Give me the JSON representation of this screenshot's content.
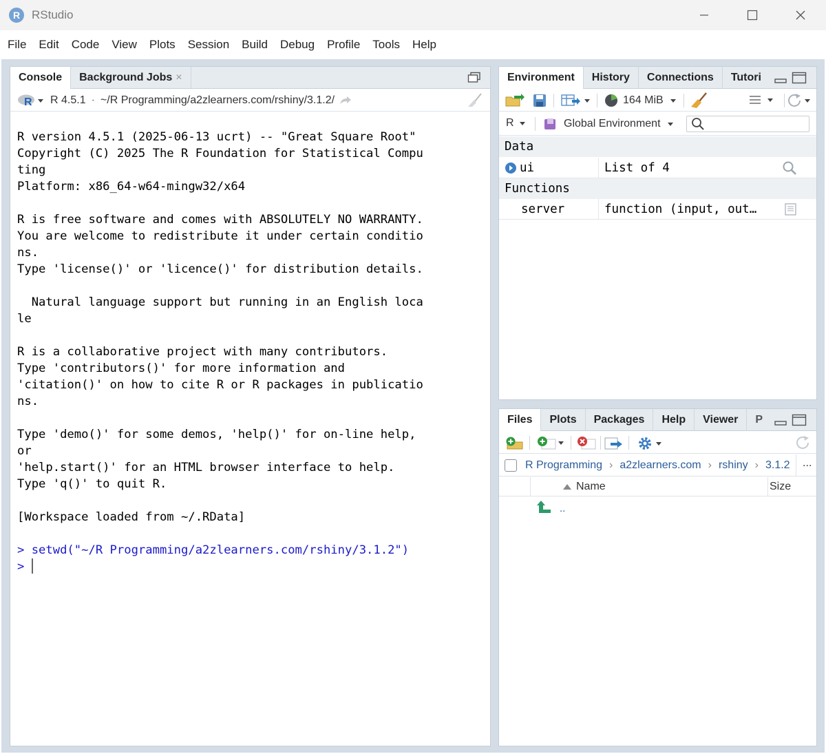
{
  "window": {
    "title": "RStudio",
    "logo_letter": "R"
  },
  "menu": [
    "File",
    "Edit",
    "Code",
    "View",
    "Plots",
    "Session",
    "Build",
    "Debug",
    "Profile",
    "Tools",
    "Help"
  ],
  "console_pane": {
    "tabs": [
      {
        "label": "Console",
        "active": true
      },
      {
        "label": "Background Jobs",
        "active": false,
        "close": "×"
      }
    ],
    "r_version": "R 4.5.1",
    "path_sep": "·",
    "path": "~/R Programming/a2zlearners.com/rshiny/3.1.2/",
    "output_lines": [
      "R version 4.5.1 (2025-06-13 ucrt) -- \"Great Square Root\"",
      "Copyright (C) 2025 The R Foundation for Statistical Compu",
      "ting",
      "Platform: x86_64-w64-mingw32/x64",
      "",
      "R is free software and comes with ABSOLUTELY NO WARRANTY.",
      "You are welcome to redistribute it under certain conditio",
      "ns.",
      "Type 'license()' or 'licence()' for distribution details.",
      "",
      "  Natural language support but running in an English loca",
      "le",
      "",
      "R is a collaborative project with many contributors.",
      "Type 'contributors()' for more information and",
      "'citation()' on how to cite R or R packages in publicatio",
      "ns.",
      "",
      "Type 'demo()' for some demos, 'help()' for on-line help,",
      "or",
      "'help.start()' for an HTML browser interface to help.",
      "Type 'q()' to quit R.",
      "",
      "[Workspace loaded from ~/.RData]"
    ],
    "command_line": "> setwd(\"~/R Programming/a2zlearners.com/rshiny/3.1.2\")",
    "prompt": "> "
  },
  "env_pane": {
    "tabs": [
      {
        "label": "Environment",
        "active": true
      },
      {
        "label": "History",
        "active": false
      },
      {
        "label": "Connections",
        "active": false
      },
      {
        "label": "Tutori",
        "active": false
      }
    ],
    "memory": "164 MiB",
    "language": "R",
    "environment": "Global Environment",
    "search_placeholder": "",
    "sections": {
      "data_header": "Data",
      "functions_header": "Functions"
    },
    "data_rows": [
      {
        "name": "ui",
        "value": "List of  4"
      }
    ],
    "function_rows": [
      {
        "name": "server",
        "value": "function (input, out…"
      }
    ]
  },
  "files_pane": {
    "tabs": [
      {
        "label": "Files",
        "active": true
      },
      {
        "label": "Plots",
        "active": false
      },
      {
        "label": "Packages",
        "active": false
      },
      {
        "label": "Help",
        "active": false
      },
      {
        "label": "Viewer",
        "active": false
      },
      {
        "label": "P",
        "active": false
      }
    ],
    "breadcrumb": [
      "R Programming",
      "a2zlearners.com",
      "rshiny",
      "3.1.2"
    ],
    "more": "...",
    "columns": {
      "name": "Name",
      "size": "Size"
    },
    "rows": [
      {
        "name": ".."
      }
    ]
  },
  "colors": {
    "tab_bg": "#e6ebf0",
    "command_blue": "#1a1acc",
    "link_blue": "#2b5d99",
    "frame": "#d4dde6"
  }
}
